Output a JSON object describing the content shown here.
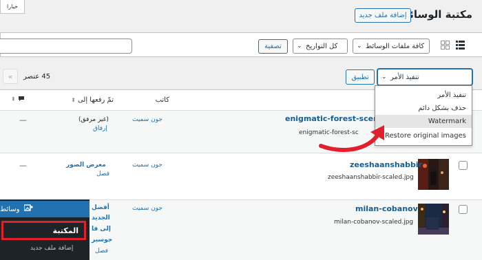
{
  "top_left_tab": "خيارا",
  "page_title": "مكتبة الوسائط",
  "add_new_button": "إضافة ملف جديد",
  "filters": {
    "media_type": "كافة ملفات الوسائط",
    "dates": "كل التواريخ",
    "filter_button": "تصفية"
  },
  "bulk": {
    "select_value": "تنفيذ الأمر",
    "apply_button": "تطبيق",
    "options": [
      "تنفيذ الأمر",
      "حذف بشكل دائم",
      "Watermark",
      "Restore original images"
    ],
    "selected_option": "Watermark"
  },
  "pagination": {
    "count": "45 عنصر",
    "first_page": "«"
  },
  "columns": {
    "author": "كاتب",
    "uploaded_to": "تمّ رفعها إلى",
    "comments_icon": "comment-icon"
  },
  "rows": [
    {
      "title": "enigmatic-forest-scene-",
      "filename": "enigmatic-forest-sc",
      "author": "جون سميث",
      "uploaded_to": "(غير مرفق)",
      "uploaded_action": "إرفاق",
      "comments": "—"
    },
    {
      "title": "zeeshaanshabbir",
      "filename": "zeeshaanshabbir-scaled.jpg",
      "author": "جون سميث",
      "uploaded_to": "معرض الصور",
      "uploaded_action": "فصل",
      "comments": "—"
    },
    {
      "title": "milan-cobanov",
      "filename": "milan-cobanov-scaled.jpg",
      "author": "جون سميث",
      "uploaded_to_lines": [
        "أفضل",
        "الجديد",
        "إلى فا",
        "جوسير"
      ],
      "uploaded_action": "فصل"
    }
  ],
  "admin_menu": {
    "media_label": "وسائط",
    "library": "المكتبة",
    "add_new": "إضافة ملف جديد"
  },
  "colors": {
    "accent": "#2271b1",
    "highlight_red": "#e0202a",
    "admin_bg": "#1d2327"
  }
}
